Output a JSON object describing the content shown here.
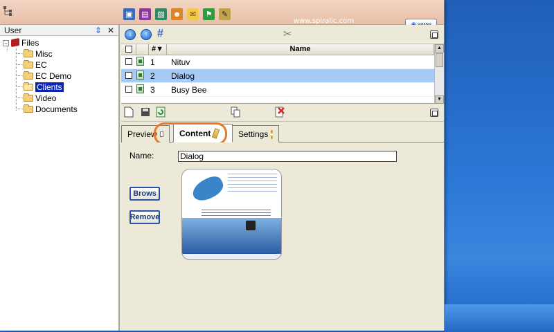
{
  "topbar": {
    "url_text": "www.spiralic.com",
    "www_button_label": "www",
    "tools": [
      "icon-1-icon",
      "book-icon",
      "image-icon",
      "users-icon",
      "mail-icon",
      "flag-icon",
      "edit-icon"
    ]
  },
  "left_panel": {
    "title": "User",
    "refresh_glyph": "⇕",
    "close_glyph": "✕",
    "tree": {
      "root": "Files",
      "expander_glyph": "−",
      "items": [
        "Misc",
        "EC",
        "EC Demo",
        "Clients",
        "Video",
        "Documents"
      ],
      "selected": "Clients"
    }
  },
  "table": {
    "col_sort": "#▼",
    "col_name": "Name",
    "rows": [
      {
        "num": "1",
        "name": "Nituv"
      },
      {
        "num": "2",
        "name": "Dialog"
      },
      {
        "num": "3",
        "name": "Busy Bee"
      }
    ],
    "selected_row": "2"
  },
  "tabs": {
    "preview": "Preview",
    "content": "Content",
    "settings": "Settings"
  },
  "content": {
    "name_label": "Name:",
    "name_value": "Dialog",
    "browse_label": "Brows",
    "remove_label": "Remove"
  },
  "colors": {
    "topbar": "#e8bfa8",
    "selection": "#a8cbf6",
    "tree_selection": "#0a24b8",
    "highlight_ring": "#e8782a",
    "desktop": "#2c78d6"
  }
}
